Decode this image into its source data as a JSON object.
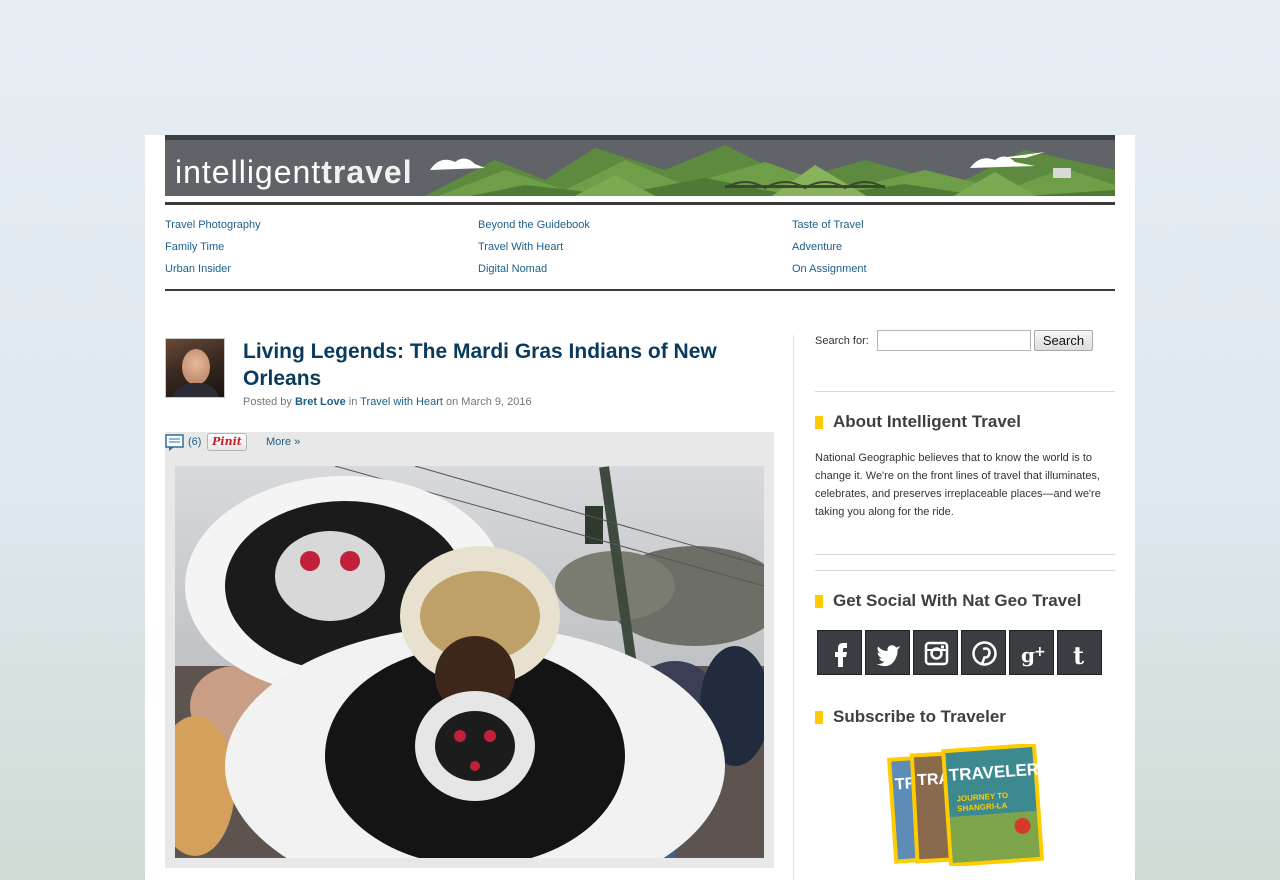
{
  "banner": {
    "logo_part1": "intelligent",
    "logo_part2": "travel"
  },
  "nav": {
    "col1": [
      "Travel Photography",
      "Family Time",
      "Urban Insider"
    ],
    "col2": [
      "Beyond the Guidebook",
      "Travel With Heart",
      "Digital Nomad"
    ],
    "col3": [
      "Taste of Travel",
      "Adventure",
      "On Assignment"
    ]
  },
  "post": {
    "title": "Living Legends: The Mardi Gras Indians of New Orleans",
    "meta_posted_by": "Posted by",
    "author": "Bret Love",
    "meta_in": "in",
    "category": "Travel with Heart",
    "meta_on": "on March 9, 2016",
    "comment_count": "(6)",
    "pinit_label": "Pinit",
    "more_label": "More »"
  },
  "sidebar": {
    "search_label": "Search for:",
    "search_value": "",
    "search_button": "Search",
    "about_title": "About Intelligent Travel",
    "about_text": "National Geographic believes that to know the world is to change it. We're on the front lines of travel that illuminates, celebrates, and preserves irreplaceable places—and we're taking you along for the ride.",
    "social_title": "Get Social With Nat Geo Travel",
    "social_icons": [
      "facebook-icon",
      "twitter-icon",
      "instagram-icon",
      "pinterest-icon",
      "google-plus-icon",
      "tumblr-icon"
    ],
    "subscribe_title": "Subscribe to Traveler",
    "magazine_cover_text": "TRAVELER",
    "magazine_cover_headline": "JOURNEY TO SHANGRI-LA"
  },
  "colors": {
    "link": "#1d5f8a",
    "title": "#0a3a5c",
    "accent": "#ffcc00"
  }
}
